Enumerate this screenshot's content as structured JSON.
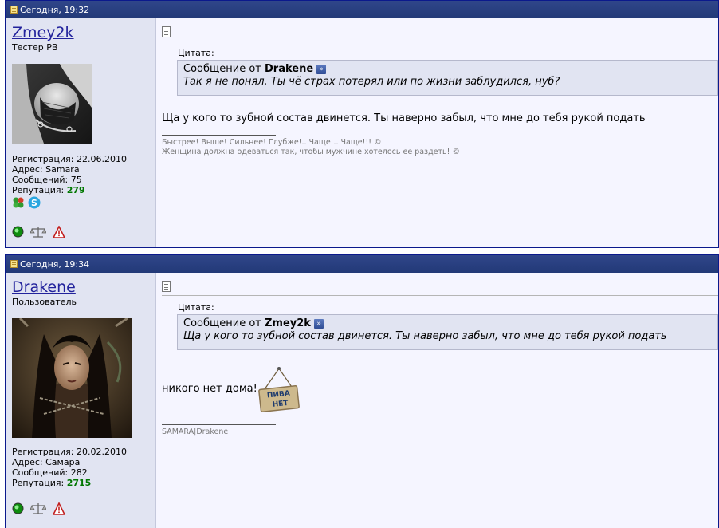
{
  "posts": [
    {
      "date": "Сегодня, 19:32",
      "username": "Zmey2k",
      "usertitle": "Тестер PB",
      "stats": {
        "registration": "Регистрация: 22.06.2010",
        "address": "Адрес: Samara",
        "messages": "Сообщений: 75",
        "reputation_label": "Репутация:",
        "reputation_value": "279"
      },
      "quote": {
        "label": "Цитата:",
        "prefix": "Сообщение от",
        "author": "Drakene",
        "text": "Так я не понял. Ты чё страх потерял или по жизни заблудился, нуб?"
      },
      "message": "Ща у кого то зубной состав двинется. Ты наверно забыл, что мне до тебя рукой подать",
      "signature": [
        "Быстрее! Выше! Сильнее! Глубже!.. Чаще!.. Чаще!!! ©",
        "Женщина должна одеваться так, чтобы мужчине хотелось ее раздеть! ©"
      ]
    },
    {
      "date": "Сегодня, 19:34",
      "username": "Drakene",
      "usertitle": "Пользователь",
      "stats": {
        "registration": "Регистрация: 20.02.2010",
        "address": "Адрес: Самара",
        "messages": "Сообщений: 282",
        "reputation_label": "Репутация:",
        "reputation_value": "2715"
      },
      "quote": {
        "label": "Цитата:",
        "prefix": "Сообщение от",
        "author": "Zmey2k",
        "text": "Ща у кого то зубной состав двинется. Ты наверно забыл, что мне до тебя рукой подать"
      },
      "message": "никого нет дома!",
      "sign_text": [
        "ПИВА",
        "НЕТ"
      ],
      "signature": [
        "SAMARA|Drakene"
      ]
    }
  ],
  "colors": {
    "header": "#223977",
    "userinfo_bg": "#e1e4f2",
    "content_bg": "#f5f5ff",
    "username": "#22229c",
    "reputation": "#017701"
  },
  "icons": [
    "post-icon",
    "online-status-icon",
    "scales-icon",
    "warning-icon",
    "clover-icon",
    "skype-icon",
    "view-post-arrow-icon"
  ]
}
